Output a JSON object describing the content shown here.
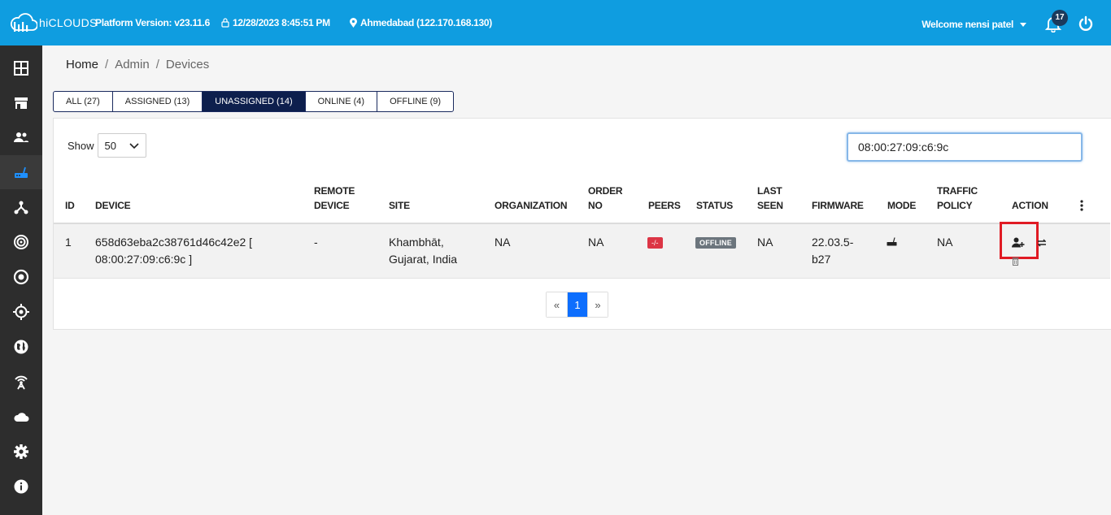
{
  "header": {
    "brand": "hiCLOUDS",
    "platform_version": "Platform Version: v23.11.6",
    "datetime": "12/28/2023 8:45:51 PM",
    "location": "Ahmedabad (122.170.168.130)",
    "welcome": "Welcome nensi patel",
    "notifications_count": "17"
  },
  "breadcrumb": {
    "home": "Home",
    "admin": "Admin",
    "current": "Devices",
    "separator": "/"
  },
  "tabs": [
    {
      "label": "ALL (27)"
    },
    {
      "label": "ASSIGNED (13)"
    },
    {
      "label": "UNASSIGNED (14)"
    },
    {
      "label": "ONLINE (4)"
    },
    {
      "label": "OFFLINE (9)"
    }
  ],
  "table_controls": {
    "show_label": "Show",
    "page_size": "50",
    "search_value": "08:00:27:09:c6:9c"
  },
  "columns": {
    "id": "ID",
    "device": "DEVICE",
    "remote_1": "REMOTE",
    "remote_2": "DEVICE",
    "site": "SITE",
    "organization": "ORGANIZATION",
    "order_1": "ORDER",
    "order_2": "NO",
    "peers": "PEERS",
    "status": "STATUS",
    "last_1": "LAST",
    "last_2": "SEEN",
    "firmware": "FIRMWARE",
    "mode": "MODE",
    "traffic_1": "TRAFFIC",
    "traffic_2": "POLICY",
    "action": "ACTION"
  },
  "rows": [
    {
      "id": "1",
      "device_1": "658d63eba2c38761d46c42e2 [",
      "device_2": "08:00:27:09:c6:9c ]",
      "remote_device": "-",
      "site_1": "Khambhāt,",
      "site_2": "Gujarat, India",
      "organization": "NA",
      "order_no": "NA",
      "peers": "-/-",
      "status": "OFFLINE",
      "last_seen": "NA",
      "firmware_1": "22.03.5-",
      "firmware_2": "b27",
      "traffic_policy": "NA"
    }
  ],
  "pagination": {
    "prev": "«",
    "current": "1",
    "next": "»"
  },
  "colors": {
    "topbar": "#0f9de0",
    "sidebar": "#2d2d2d",
    "active_tab": "#0d1f4d",
    "peers_badge": "#dc3545",
    "status_badge": "#6c757d",
    "highlight_box": "#e01b24",
    "page_active": "#0d6efd"
  },
  "sidebar_icons": [
    "dashboard-icon",
    "store-icon",
    "users-icon",
    "router-icon",
    "network-icon",
    "signal-icon",
    "target-icon",
    "crosshair-icon",
    "globe-icon",
    "antenna-icon",
    "cloud-icon",
    "settings-icon",
    "info-icon"
  ]
}
